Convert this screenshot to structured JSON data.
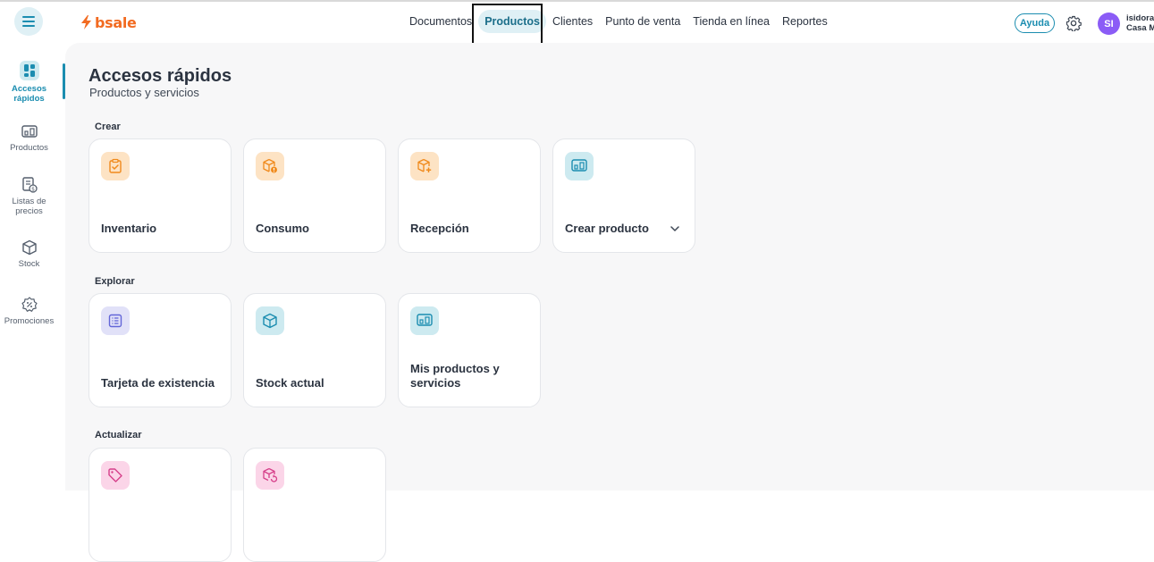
{
  "brand": {
    "name": "bsale",
    "color": "#f26b21"
  },
  "top_nav": {
    "items": [
      {
        "label": "Documentos"
      },
      {
        "label": "Productos",
        "active": true
      },
      {
        "label": "Clientes"
      },
      {
        "label": "Punto de venta"
      },
      {
        "label": "Tienda en línea"
      },
      {
        "label": "Reportes"
      }
    ]
  },
  "header": {
    "help_label": "Ayuda",
    "settings_icon": "gear-icon",
    "avatar_initials": "SI",
    "user_name": "isidora",
    "user_company": "Casa M"
  },
  "sidebar": {
    "items": [
      {
        "label": "Accesos rápidos",
        "icon": "dashboard-icon",
        "active": true
      },
      {
        "label": "Productos",
        "icon": "products-icon"
      },
      {
        "label": "Listas de precios",
        "icon": "price-list-icon"
      },
      {
        "label": "Stock",
        "icon": "box-icon"
      },
      {
        "label": "Promociones",
        "icon": "discount-badge-icon"
      }
    ]
  },
  "main": {
    "title": "Accesos rápidos",
    "subtitle": "Productos y servicios",
    "sections": [
      {
        "label": "Crear",
        "cards": [
          {
            "label": "Inventario",
            "icon": "clipboard-check-icon",
            "icon_color": "#f08a1c"
          },
          {
            "label": "Consumo",
            "icon": "box-alert-icon",
            "icon_color": "#f08a1c"
          },
          {
            "label": "Recepción",
            "icon": "box-plus-icon",
            "icon_color": "#f08a1c"
          },
          {
            "label": "Crear producto",
            "icon": "products-icon",
            "icon_color": "#1b8db0",
            "has_dropdown": true
          }
        ]
      },
      {
        "label": "Explorar",
        "cards": [
          {
            "label": "Tarjeta de existencia",
            "icon": "list-card-icon",
            "icon_color": "#6366d8"
          },
          {
            "label": "Stock actual",
            "icon": "box-icon",
            "icon_color": "#1b8db0"
          },
          {
            "label": "Mis productos y servicios",
            "icon": "products-icon",
            "icon_color": "#1b8db0"
          }
        ]
      },
      {
        "label": "Actualizar",
        "cards": [
          {
            "label": "",
            "icon": "tag-icon",
            "icon_color": "#d6408a"
          },
          {
            "label": "",
            "icon": "box-refresh-icon",
            "icon_color": "#d6408a"
          }
        ]
      }
    ]
  }
}
